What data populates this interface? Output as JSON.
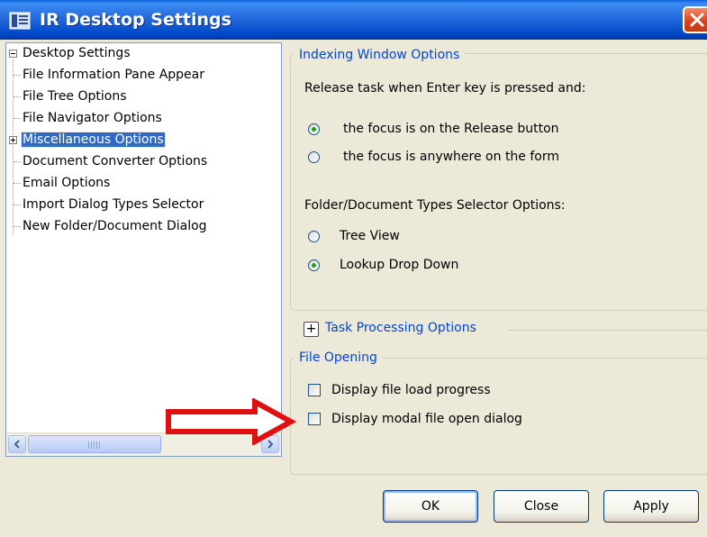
{
  "window": {
    "title": "IR Desktop Settings"
  },
  "tree": {
    "root": "Desktop Settings",
    "items": [
      {
        "label": "File Information Pane Appear"
      },
      {
        "label": "File Tree Options"
      },
      {
        "label": "File Navigator Options"
      },
      {
        "label": "Miscellaneous Options",
        "selected": true,
        "expandable": true
      },
      {
        "label": "Document Converter Options"
      },
      {
        "label": "Email Options"
      },
      {
        "label": "Import Dialog Types Selector"
      },
      {
        "label": "New Folder/Document Dialog"
      }
    ]
  },
  "indexing": {
    "title": "Indexing Window Options",
    "release_prompt": "Release task when Enter key is pressed and:",
    "release_options": [
      {
        "label": "the focus is on the Release button",
        "checked": true
      },
      {
        "label": "the focus is anywhere on the form",
        "checked": false
      }
    ],
    "selector_prompt": "Folder/Document Types Selector Options:",
    "selector_options": [
      {
        "label": "Tree View",
        "checked": false
      },
      {
        "label": "Lookup Drop Down",
        "checked": true
      }
    ]
  },
  "task_processing": {
    "title": "Task Processing Options",
    "expand_symbol": "+"
  },
  "file_opening": {
    "title": "File Opening",
    "options": [
      {
        "label": "Display file load progress",
        "checked": false
      },
      {
        "label": "Display modal file open dialog",
        "checked": false
      }
    ]
  },
  "buttons": {
    "ok": "OK",
    "close": "Close",
    "apply": "Apply"
  },
  "colors": {
    "titlebar": "#0048c8",
    "group_title": "#0046d5",
    "selection": "#316ac5",
    "annotation_arrow": "#e01010"
  }
}
